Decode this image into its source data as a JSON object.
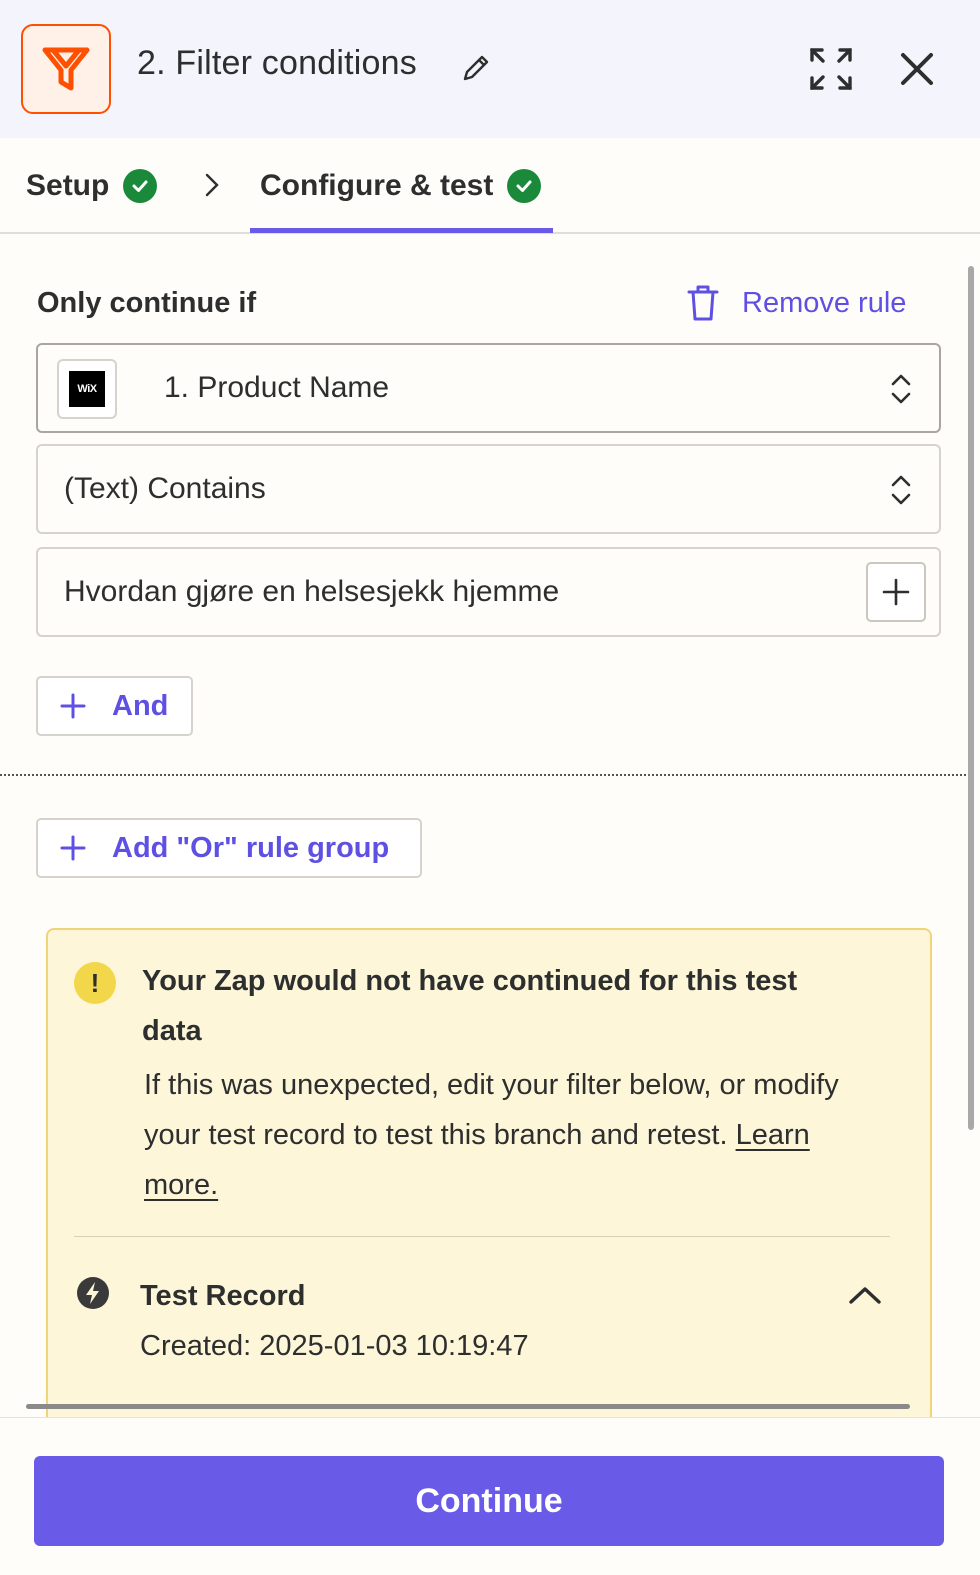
{
  "header": {
    "title": "2. Filter conditions",
    "app_icon": "filter-funnel-icon",
    "brand_color": "#ff4f00"
  },
  "tabs": [
    {
      "label": "Setup",
      "status": "complete"
    },
    {
      "label": "Configure & test",
      "status": "complete",
      "active": true
    }
  ],
  "rule": {
    "section_label": "Only continue if",
    "remove_label": "Remove rule",
    "field": {
      "app_logo_text": "WiX",
      "value": "1. Product Name"
    },
    "condition": {
      "value": "(Text) Contains"
    },
    "match_value": {
      "value": "Hvordan gjøre en helsesjekk hjemme"
    },
    "and_label": "And"
  },
  "or_group_label": "Add \"Or\" rule group",
  "alert": {
    "title": "Your Zap would not have continued for this test data",
    "body": "If this was unexpected, edit your filter below, or modify your test record to test this branch and retest.",
    "link": "Learn more.",
    "record_title": "Test Record",
    "record_created": "Created: 2025-01-03 10:19:47"
  },
  "footer": {
    "continue_label": "Continue"
  },
  "colors": {
    "accent": "#695be8",
    "success": "#1a8a3a",
    "warning_bg": "#fdf6d9"
  }
}
